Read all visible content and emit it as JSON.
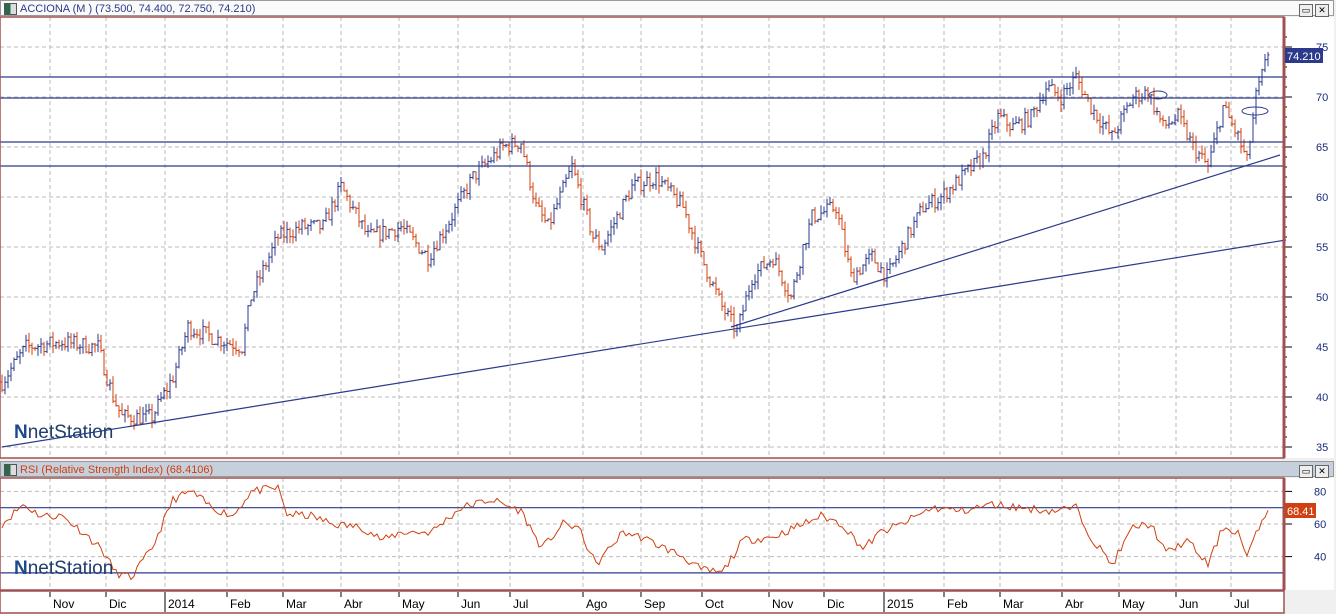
{
  "main_title": "ACCIONA (M ) (73.500, 74.400, 72.750, 74.210)",
  "rsi_title": "RSI (Relative Strength Index) (68.4106)",
  "logo": "netStation",
  "colors": {
    "up": "#2b3a8c",
    "down": "#d04010",
    "line": "#2b3a8c",
    "rsi": "#d04010",
    "frame": "#a05050"
  },
  "chart_data": [
    {
      "type": "ohlc",
      "title": "ACCIONA (M )",
      "last_label": "74.210",
      "ylim": [
        34,
        77
      ],
      "yticks": [
        35,
        40,
        45,
        50,
        55,
        60,
        65,
        70,
        75
      ],
      "x_labels": [
        "Nov",
        "Dic",
        "2014",
        "Feb",
        "Mar",
        "Abr",
        "May",
        "Jun",
        "Jul",
        "Ago",
        "Sep",
        "Oct",
        "Nov",
        "Dic",
        "2015",
        "Feb",
        "Mar",
        "Abr",
        "May",
        "Jun",
        "Jul"
      ],
      "close_anchors": [
        [
          0,
          41.5
        ],
        [
          8,
          45
        ],
        [
          20,
          45.5
        ],
        [
          32,
          45
        ],
        [
          37,
          40
        ],
        [
          40,
          38
        ],
        [
          50,
          38
        ],
        [
          57,
          42
        ],
        [
          62,
          47
        ],
        [
          70,
          46
        ],
        [
          80,
          45
        ],
        [
          83,
          50
        ],
        [
          92,
          56
        ],
        [
          100,
          57
        ],
        [
          107,
          57
        ],
        [
          113,
          61
        ],
        [
          122,
          56
        ],
        [
          133,
          57
        ],
        [
          142,
          54
        ],
        [
          148,
          57
        ],
        [
          157,
          62
        ],
        [
          167,
          65
        ],
        [
          173,
          65.5
        ],
        [
          178,
          59
        ],
        [
          182,
          57
        ],
        [
          190,
          63
        ],
        [
          197,
          56
        ],
        [
          200,
          55
        ],
        [
          210,
          61
        ],
        [
          218,
          62
        ],
        [
          227,
          59
        ],
        [
          233,
          54
        ],
        [
          240,
          49
        ],
        [
          245,
          46.5
        ],
        [
          250,
          52
        ],
        [
          257,
          54
        ],
        [
          263,
          50
        ],
        [
          267,
          55
        ],
        [
          270,
          58
        ],
        [
          278,
          59
        ],
        [
          283,
          52
        ],
        [
          290,
          54
        ],
        [
          295,
          52
        ],
        [
          300,
          55
        ],
        [
          307,
          59
        ],
        [
          313,
          60
        ],
        [
          320,
          62
        ],
        [
          327,
          64
        ],
        [
          332,
          68
        ],
        [
          337,
          67
        ],
        [
          343,
          68
        ],
        [
          348,
          71
        ],
        [
          353,
          70
        ],
        [
          358,
          72
        ],
        [
          363,
          69
        ],
        [
          370,
          66
        ],
        [
          377,
          70
        ],
        [
          382,
          70.5
        ],
        [
          387,
          67
        ],
        [
          392,
          68
        ],
        [
          397,
          65
        ],
        [
          402,
          63
        ],
        [
          407,
          69
        ],
        [
          412,
          66
        ],
        [
          415,
          63.5
        ],
        [
          418,
          70
        ],
        [
          422,
          74.21
        ]
      ],
      "horizontal_levels": [
        72.0,
        69.9,
        65.5,
        63.1
      ],
      "trendlines": [
        [
          [
            0,
            35.0
          ],
          [
            428,
            55.7
          ]
        ],
        [
          [
            243,
            47.0
          ],
          [
            426,
            64.2
          ]
        ]
      ]
    },
    {
      "type": "line",
      "title": "RSI (Relative Strength Index)",
      "last_label": "68.41",
      "ylim": [
        22,
        85
      ],
      "yticks": [
        40,
        60,
        80
      ],
      "levels": [
        70,
        30
      ],
      "anchors": [
        [
          0,
          60
        ],
        [
          7,
          72
        ],
        [
          13,
          65
        ],
        [
          20,
          65
        ],
        [
          27,
          55
        ],
        [
          33,
          45
        ],
        [
          38,
          30
        ],
        [
          43,
          27
        ],
        [
          50,
          45
        ],
        [
          57,
          75
        ],
        [
          63,
          80
        ],
        [
          70,
          70
        ],
        [
          77,
          65
        ],
        [
          83,
          80
        ],
        [
          92,
          82
        ],
        [
          95,
          66
        ],
        [
          103,
          65
        ],
        [
          110,
          60
        ],
        [
          120,
          58
        ],
        [
          127,
          50
        ],
        [
          133,
          55
        ],
        [
          143,
          55
        ],
        [
          153,
          70
        ],
        [
          163,
          75
        ],
        [
          173,
          68
        ],
        [
          180,
          45
        ],
        [
          187,
          60
        ],
        [
          192,
          58
        ],
        [
          198,
          35
        ],
        [
          207,
          55
        ],
        [
          213,
          52
        ],
        [
          227,
          40
        ],
        [
          233,
          32
        ],
        [
          240,
          30
        ],
        [
          247,
          50
        ],
        [
          257,
          52
        ],
        [
          267,
          60
        ],
        [
          273,
          65
        ],
        [
          280,
          60
        ],
        [
          287,
          45
        ],
        [
          293,
          55
        ],
        [
          300,
          60
        ],
        [
          310,
          70
        ],
        [
          320,
          68
        ],
        [
          330,
          72
        ],
        [
          340,
          70
        ],
        [
          350,
          68
        ],
        [
          358,
          70
        ],
        [
          363,
          52
        ],
        [
          370,
          35
        ],
        [
          377,
          58
        ],
        [
          383,
          60
        ],
        [
          388,
          42
        ],
        [
          395,
          50
        ],
        [
          402,
          35
        ],
        [
          407,
          58
        ],
        [
          412,
          55
        ],
        [
          415,
          40
        ],
        [
          420,
          62
        ],
        [
          422,
          68.4
        ]
      ]
    }
  ]
}
